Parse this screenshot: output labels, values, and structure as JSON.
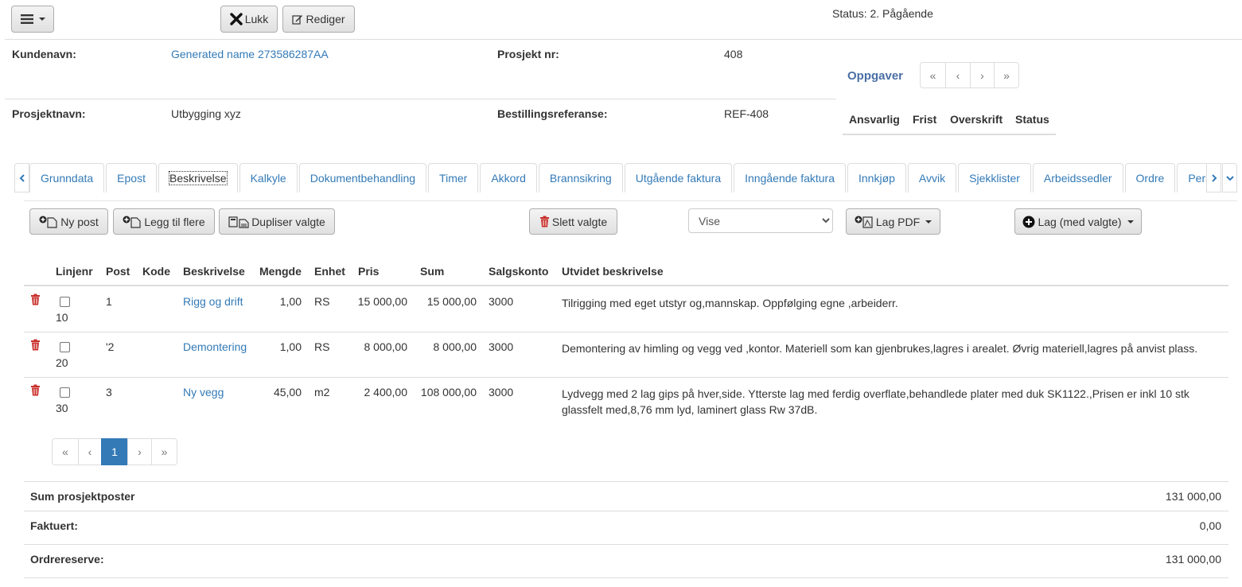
{
  "header": {
    "lukk_label": "Lukk",
    "rediger_label": "Rediger",
    "status": "Status: 2. Pågående"
  },
  "info": {
    "kundenavn_label": "Kundenavn:",
    "kundenavn_value": "Generated name 273586287AA",
    "prosjektnr_label": "Prosjekt nr:",
    "prosjektnr_value": "408",
    "prosjektnavn_label": "Prosjektnavn:",
    "prosjektnavn_value": "Utbygging xyz",
    "bestref_label": "Bestillingsreferanse:",
    "bestref_value": "REF-408"
  },
  "oppgaver": {
    "title": "Oppgaver",
    "pager": [
      "«",
      "‹",
      "›",
      "»"
    ],
    "columns": [
      "Ansvarlig",
      "Frist",
      "Overskrift",
      "Status"
    ]
  },
  "tabs": [
    "Grunndata",
    "Epost",
    "Beskrivelse",
    "Kalkyle",
    "Dokumentbehandling",
    "Timer",
    "Akkord",
    "Brannsikring",
    "Utgående faktura",
    "Inngående faktura",
    "Innkjøp",
    "Avvik",
    "Sjekklister",
    "Arbeidssedler",
    "Ordre",
    "Persona"
  ],
  "active_tab": "Beskrivelse",
  "toolbar": {
    "ny_post": "Ny post",
    "legg_til_flere": "Legg til flere",
    "dupliser_valgte": "Dupliser valgte",
    "slett_valgte": "Slett valgte",
    "vise_selected": "Vise",
    "lag_pdf": "Lag PDF",
    "lag_med_valgte": "Lag (med valgte)"
  },
  "table": {
    "columns": [
      "Linjenr",
      "Post",
      "Kode",
      "Beskrivelse",
      "Mengde",
      "Enhet",
      "Pris",
      "Sum",
      "Salgskonto",
      "Utvidet beskrivelse"
    ],
    "rows": [
      {
        "linjenr": "10",
        "post": "1",
        "kode": "",
        "beskrivelse": "Rigg og drift",
        "mengde": "1,00",
        "enhet": "RS",
        "pris": "15 000,00",
        "sum": "15 000,00",
        "salgskonto": "3000",
        "utvidet": "Tilrigging med eget utstyr og,mannskap. Oppfølging egne ,arbeiderr."
      },
      {
        "linjenr": "20",
        "post": "'2",
        "kode": "",
        "beskrivelse": "Demontering",
        "mengde": "1,00",
        "enhet": "RS",
        "pris": "8 000,00",
        "sum": "8 000,00",
        "salgskonto": "3000",
        "utvidet": "Demontering av himling og vegg ved ,kontor. Materiell som kan gjenbrukes,lagres i arealet. Øvrig materiell,lagres på anvist plass."
      },
      {
        "linjenr": "30",
        "post": "3",
        "kode": "",
        "beskrivelse": "Ny vegg",
        "mengde": "45,00",
        "enhet": "m2",
        "pris": "2 400,00",
        "sum": "108 000,00",
        "salgskonto": "3000",
        "utvidet": "Lydvegg med 2 lag gips på hver,side. Ytterste lag med ferdig overflate,behandlede plater med duk SK1122.,Prisen er inkl 10 stk glassfelt med,8,76 mm lyd, laminert glass Rw 37dB."
      }
    ],
    "pager": [
      "«",
      "‹",
      "1",
      "›",
      "»"
    ]
  },
  "summary": {
    "sum_label": "Sum prosjektposter",
    "sum_value": "131 000,00",
    "fakturert_label": "Faktuert:",
    "fakturert_value": "0,00",
    "ordrereserve_label": "Ordrereserve:",
    "ordrereserve_value": "131 000,00"
  }
}
